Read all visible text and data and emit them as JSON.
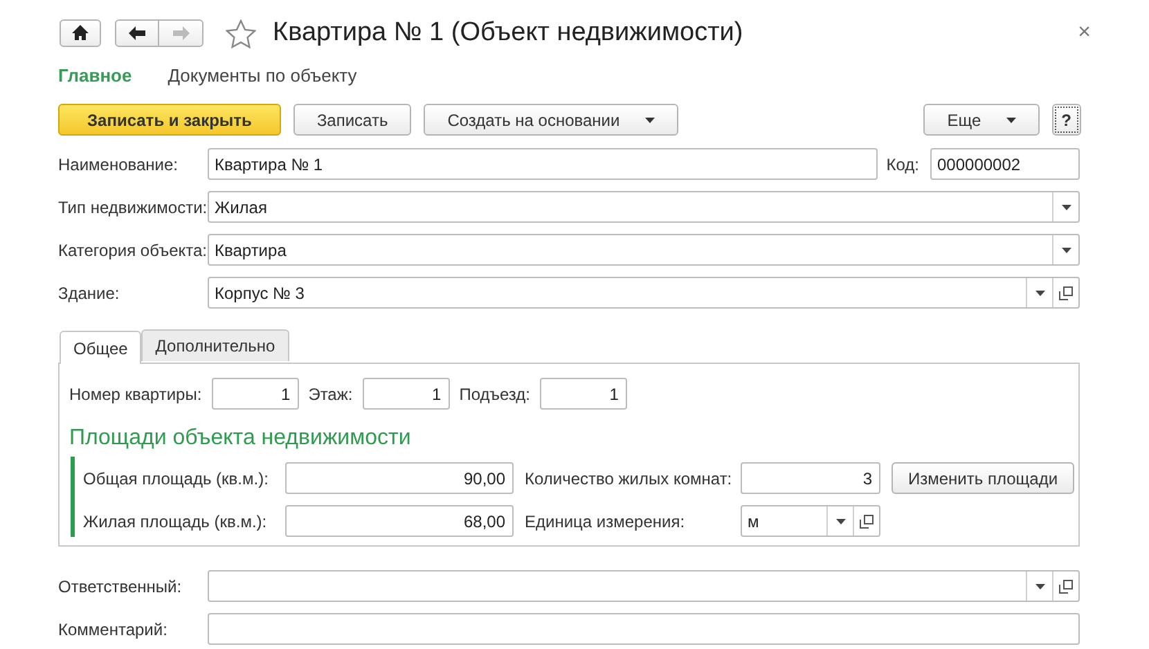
{
  "nav": [
    {
      "kind": "home",
      "disabled": false
    },
    {
      "kind": "back",
      "disabled": false
    },
    {
      "kind": "forward",
      "disabled": true
    }
  ],
  "window": {
    "title": "Квартира № 1 (Объект недвижимости)",
    "close": "×"
  },
  "sections": [
    {
      "label": "Главное",
      "selected": true
    },
    {
      "label": "Документы по объекту",
      "selected": false
    }
  ],
  "toolbar": [
    {
      "label": "Записать и закрыть",
      "kind": "primary"
    },
    {
      "label": "Записать",
      "kind": "plain"
    },
    {
      "label": "Создать на основании",
      "kind": "dropdown"
    },
    {
      "label": "Еще",
      "kind": "dropdown"
    },
    {
      "label": "?",
      "kind": "help"
    }
  ],
  "name_row": {
    "label": "Наименование:",
    "value": "Квартира № 1",
    "code_label": "Код:",
    "code_value": "000000002"
  },
  "fields": [
    {
      "label": "Тип недвижимости:",
      "value": "Жилая",
      "kind": "select",
      "open_button": false
    },
    {
      "label": "Категория объекта:",
      "value": "Квартира",
      "kind": "select",
      "open_button": false
    },
    {
      "label": "Здание:",
      "value": "Корпус № 3",
      "kind": "select",
      "open_button": true
    }
  ],
  "tabs": [
    {
      "label": "Общее",
      "selected": true
    },
    {
      "label": "Дополнительно",
      "selected": false
    }
  ],
  "apartment_row": [
    {
      "label": "Номер квартиры:",
      "value": "1"
    },
    {
      "label": "Этаж:",
      "value": "1"
    },
    {
      "label": "Подъезд:",
      "value": "1"
    }
  ],
  "areas": {
    "title": "Площади объекта недвижимости",
    "rows": [
      {
        "label": "Общая площадь (кв.м.):",
        "value": "90,00",
        "second": {
          "label": "Количество жилых комнат:",
          "value": "3",
          "kind": "number"
        },
        "button": "Изменить площади"
      },
      {
        "label": "Жилая площадь (кв.м.):",
        "value": "68,00",
        "second": {
          "label": "Единица измерения:",
          "value": "м",
          "kind": "select",
          "open_button": true
        }
      }
    ]
  },
  "bottom_fields": [
    {
      "label": "Ответственный:",
      "kind": "select",
      "open_button": true
    },
    {
      "label": "Комментарий:",
      "kind": "text"
    }
  ]
}
